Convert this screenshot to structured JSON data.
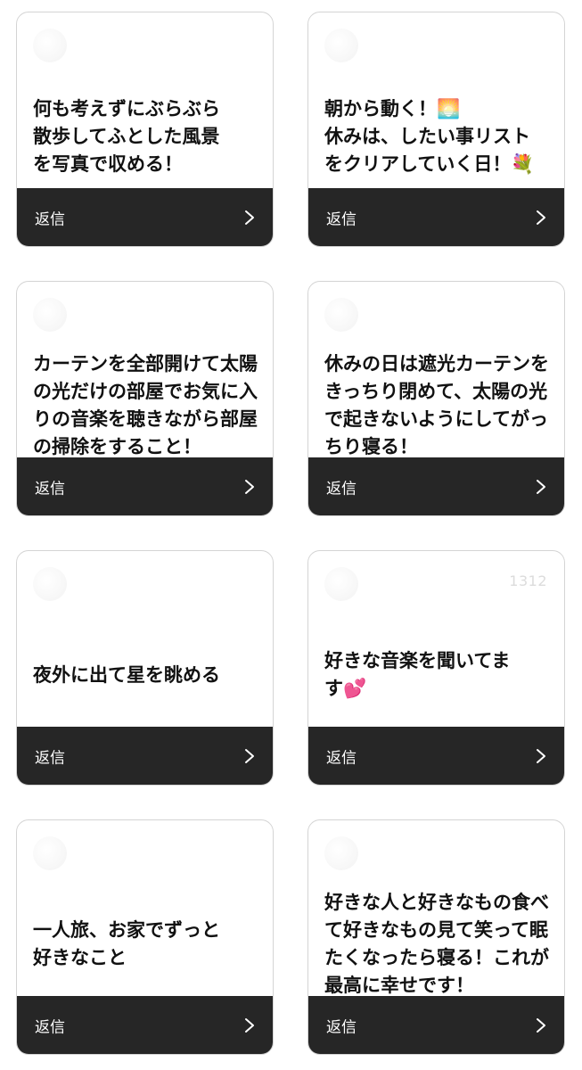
{
  "cards": [
    {
      "message": "何も考えずにぶらぶら\n散歩してふとした風景\nを写真で収める！",
      "handle": "",
      "reply_label": "返信",
      "chevron_icon": "chevron-right-icon"
    },
    {
      "message": "朝から動く！🌅\n休みは、したい事リスト\nをクリアしていく日！💐",
      "handle": "",
      "reply_label": "返信",
      "chevron_icon": "chevron-right-icon"
    },
    {
      "message": "カーテンを全部開けて太陽\nの光だけの部屋でお気に入\nりの音楽を聴きながら部屋\nの掃除をすること！",
      "handle": "",
      "reply_label": "返信",
      "chevron_icon": "chevron-right-icon"
    },
    {
      "message": "休みの日は遮光カーテンを\nきっちり閉めて、太陽の光\nで起きないようにしてがっ\nちり寝る！",
      "handle": "",
      "reply_label": "返信",
      "chevron_icon": "chevron-right-icon"
    },
    {
      "message": "夜外に出て星を眺める",
      "handle": "",
      "reply_label": "返信",
      "chevron_icon": "chevron-right-icon"
    },
    {
      "message": "好きな音楽を聞いてま\nす💕",
      "handle": "1312",
      "reply_label": "返信",
      "chevron_icon": "chevron-right-icon"
    },
    {
      "message": "一人旅、お家でずっと\n好きなこと",
      "handle": "",
      "reply_label": "返信",
      "chevron_icon": "chevron-right-icon"
    },
    {
      "message": "好きな人と好きなもの食べ\nて好きなもの見て笑って眠\nたくなったら寝る！これが\n最高に幸せです！",
      "handle": "",
      "reply_label": "返信",
      "chevron_icon": "chevron-right-icon"
    }
  ],
  "colors": {
    "card_border": "#d4d4d4",
    "reply_bar": "#262626",
    "text": "#111111"
  }
}
